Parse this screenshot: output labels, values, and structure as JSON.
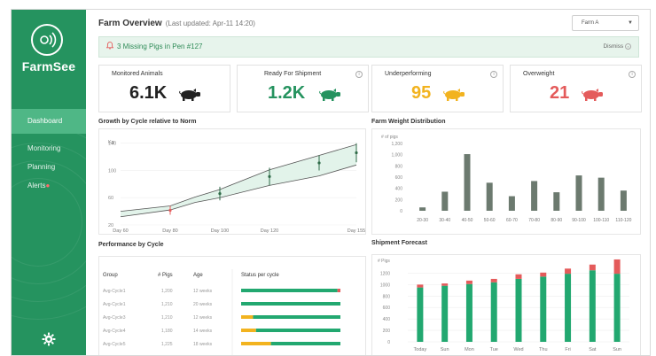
{
  "sidebar": {
    "brand": "FarmSee",
    "nav": [
      {
        "label": "Dashboard",
        "active": true
      },
      {
        "label": "Monitoring"
      },
      {
        "label": "Planning"
      },
      {
        "label": "Alerts",
        "badge": "●"
      }
    ]
  },
  "header": {
    "title": "Farm Overview",
    "updated": "(Last updated: Apr-11 14:20)",
    "farm_select": "Farm A"
  },
  "alert": {
    "text": "3 Missing Pigs in Pen #127",
    "dismiss": "Dismiss"
  },
  "kpis": [
    {
      "label": "Monitored Animals",
      "value": "6.1K",
      "color": "#222222"
    },
    {
      "label": "Ready For Shipment",
      "value": "1.2K",
      "color": "#25935f"
    },
    {
      "label": "Underperforming",
      "value": "95",
      "color": "#f2b31f"
    },
    {
      "label": "Overweight",
      "value": "21",
      "color": "#e45b5b"
    }
  ],
  "panels": {
    "growth": "Growth by Cycle relative to Norm",
    "weight": "Farm Weight Distribution",
    "performance": "Performance by Cycle",
    "shipment": "Shipment Forecast"
  },
  "performance_table": {
    "headers": [
      "Group",
      "# Pigs",
      "Age",
      "Status per cycle"
    ],
    "rows": [
      {
        "group": "Avg-Cycle1",
        "pigs": "1,200",
        "age": "12 weeks",
        "green": 0.97,
        "yellow": 0.0,
        "red": 0.03
      },
      {
        "group": "Avg-Cycle1",
        "pigs": "1,210",
        "age": "20 weeks",
        "green": 1.0,
        "yellow": 0.0,
        "red": 0.0
      },
      {
        "group": "Avg-Cycle3",
        "pigs": "1,210",
        "age": "12 weeks",
        "green": 0.88,
        "yellow": 0.12,
        "red": 0.0
      },
      {
        "group": "Avg-Cycle4",
        "pigs": "1,180",
        "age": "14 weeks",
        "green": 0.85,
        "yellow": 0.15,
        "red": 0.0
      },
      {
        "group": "Avg-Cycle5",
        "pigs": "1,225",
        "age": "18 weeks",
        "green": 0.7,
        "yellow": 0.3,
        "red": 0.0
      }
    ]
  },
  "chart_data": [
    {
      "type": "line",
      "title": "Growth by Cycle relative to Norm",
      "ylabel": "Kg",
      "yticks": [
        20,
        60,
        100,
        140
      ],
      "ylim": [
        20,
        150
      ],
      "x": [
        "Day 60",
        "Day 80",
        "Day 100",
        "Day 120",
        "Day 155"
      ],
      "x_values": [
        60,
        80,
        100,
        120,
        155
      ],
      "series": [
        {
          "role": "upper",
          "values": [
            [
              60,
              40
            ],
            [
              80,
              48
            ],
            [
              90,
              61
            ],
            [
              100,
              72
            ],
            [
              120,
              101
            ],
            [
              140,
              122
            ],
            [
              155,
              138
            ]
          ]
        },
        {
          "role": "lower",
          "values": [
            [
              60,
              32
            ],
            [
              80,
              42
            ],
            [
              90,
              53
            ],
            [
              100,
              60
            ],
            [
              120,
              78
            ],
            [
              140,
              92
            ],
            [
              155,
              108
            ]
          ]
        }
      ],
      "range_markers": [
        {
          "x": 80,
          "low": 35,
          "high": 48,
          "color": "#e45b5b"
        },
        {
          "x": 100,
          "low": 56,
          "high": 76,
          "color": "#2f6b48"
        },
        {
          "x": 120,
          "low": 78,
          "high": 104,
          "color": "#2f6b48"
        },
        {
          "x": 140,
          "low": 100,
          "high": 122,
          "color": "#2f6b48"
        },
        {
          "x": 155,
          "low": 112,
          "high": 140,
          "color": "#2f6b48"
        }
      ]
    },
    {
      "type": "bar",
      "title": "Farm Weight Distribution",
      "ylabel": "# of pigs",
      "yticks": [
        0,
        200,
        400,
        600,
        800,
        1000,
        1200
      ],
      "ytick_labels": [
        "0",
        "200",
        "400",
        "600",
        "800",
        "1,000",
        "1,200"
      ],
      "ylim": [
        0,
        1200
      ],
      "categories": [
        "20-30",
        "30-40",
        "40-50",
        "50-60",
        "60-70",
        "70-80",
        "80-90",
        "90-100",
        "100-110",
        "110-120"
      ],
      "values": [
        60,
        340,
        1010,
        500,
        260,
        530,
        330,
        630,
        590,
        360
      ],
      "color": "#6c7a6f"
    },
    {
      "type": "bar",
      "title": "Shipment Forecast",
      "ylabel": "# Pigs",
      "yticks": [
        0,
        200,
        400,
        600,
        800,
        1000,
        1200
      ],
      "ylim": [
        0,
        1300
      ],
      "categories": [
        "Today",
        "Sun",
        "Mon",
        "Tue",
        "Wed",
        "Thu",
        "Fri",
        "Sat",
        "Sun"
      ],
      "series": [
        {
          "name": "",
          "values": [
            950,
            980,
            1010,
            1040,
            1100,
            1140,
            1190,
            1250,
            1190
          ],
          "color": "#22a870"
        },
        {
          "name": "",
          "values": [
            50,
            40,
            60,
            60,
            80,
            70,
            90,
            100,
            250
          ],
          "color": "#e45b5b"
        }
      ],
      "stacked": true
    }
  ]
}
